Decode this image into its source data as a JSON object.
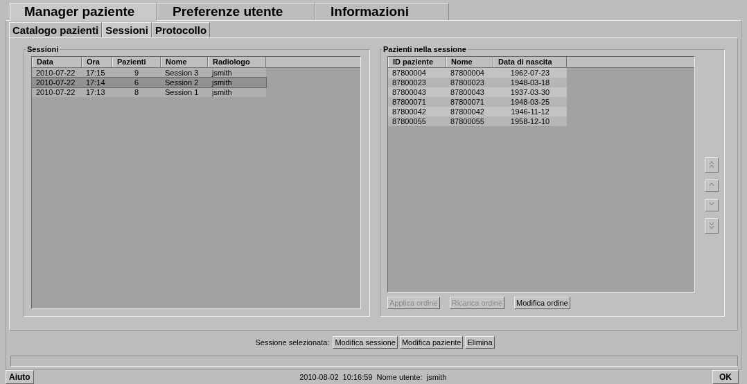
{
  "main_tabs": [
    {
      "label": "Manager paziente",
      "selected": true
    },
    {
      "label": "Preferenze utente",
      "selected": false
    },
    {
      "label": "Informazioni",
      "selected": false
    }
  ],
  "sub_tabs": [
    {
      "label": "Catalogo pazienti",
      "selected": false
    },
    {
      "label": "Sessioni",
      "selected": true
    },
    {
      "label": "Protocollo",
      "selected": false
    }
  ],
  "sessions": {
    "title": "Sessioni",
    "columns": [
      "Data",
      "Ora",
      "Pazienti",
      "Nome",
      "Radiologo"
    ],
    "rows": [
      {
        "cells": [
          "2010-07-22",
          "17:15",
          "9",
          "Session 3",
          "jsmith"
        ],
        "selected": false
      },
      {
        "cells": [
          "2010-07-22",
          "17:14",
          "6",
          "Session 2",
          "jsmith"
        ],
        "selected": true
      },
      {
        "cells": [
          "2010-07-22",
          "17:13",
          "8",
          "Session 1",
          "jsmith"
        ],
        "selected": false
      }
    ]
  },
  "patients": {
    "title": "Pazienti nella sessione",
    "columns": [
      "ID paziente",
      "Nome",
      "Data di nascita"
    ],
    "rows": [
      [
        "87800004",
        "87800004",
        "1962-07-23"
      ],
      [
        "87800023",
        "87800023",
        "1948-03-18"
      ],
      [
        "87800043",
        "87800043",
        "1937-03-30"
      ],
      [
        "87800071",
        "87800071",
        "1948-03-25"
      ],
      [
        "87800042",
        "87800042",
        "1946-11-12"
      ],
      [
        "87800055",
        "87800055",
        "1958-12-10"
      ]
    ],
    "move_buttons": [
      {
        "kind": "top"
      },
      {
        "kind": "up"
      },
      {
        "kind": "down"
      },
      {
        "kind": "bottom"
      }
    ],
    "order_buttons": [
      {
        "label": "Applica ordine",
        "disabled": true
      },
      {
        "label": "Ricarica ordine",
        "disabled": true
      },
      {
        "label": "Modifica ordine",
        "disabled": false
      }
    ]
  },
  "selected_session": {
    "label": "Sessione selezionata:",
    "buttons": [
      "Modifica sessione",
      "Modifica paziente",
      "Elimina"
    ]
  },
  "footer": {
    "help_button": "Aiuto",
    "status": "2010-08-02  10:16:59  Nome utente:  jsmith",
    "ok_button": "OK"
  }
}
